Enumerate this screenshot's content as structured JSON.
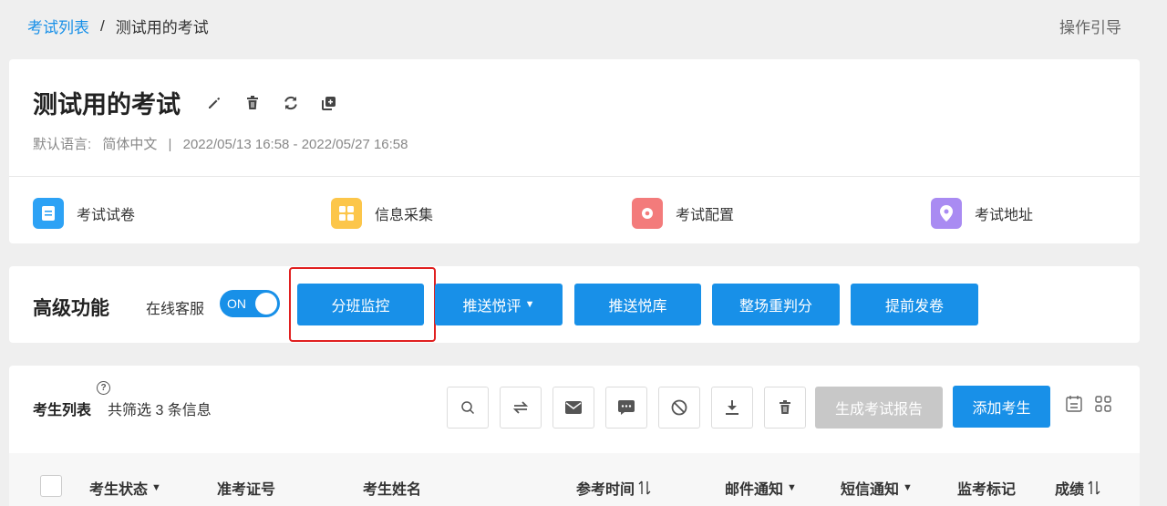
{
  "breadcrumb": {
    "parent": "考试列表",
    "separator": "/",
    "current": "测试用的考试"
  },
  "guide_label": "操作引导",
  "exam": {
    "title": "测试用的考试",
    "language_label": "默认语言:",
    "language": "简体中文",
    "meta_separator": "|",
    "date_range": "2022/05/13 16:58 - 2022/05/27 16:58",
    "features": [
      {
        "label": "考试试卷",
        "color": "#2da2f5"
      },
      {
        "label": "信息采集",
        "color": "#fcc64a"
      },
      {
        "label": "考试配置",
        "color": "#f37b7b"
      },
      {
        "label": "考试地址",
        "color": "#a98bf2"
      }
    ]
  },
  "advanced": {
    "title": "高级功能",
    "customer_service_label": "在线客服",
    "toggle_text": "ON",
    "buttons": {
      "class_monitor": "分班监控",
      "push_review": "推送悦评",
      "push_library": "推送悦库",
      "rejudge": "整场重判分",
      "early_submit": "提前发卷"
    }
  },
  "candidates": {
    "title": "考生列表",
    "help_symbol": "?",
    "count_text": "共筛选 3 条信息",
    "generate_report": "生成考试报告",
    "add_candidate": "添加考生",
    "columns": {
      "status": "考生状态",
      "ticket": "准考证号",
      "name": "考生姓名",
      "time": "参考时间",
      "email": "邮件通知",
      "sms": "短信通知",
      "proctor": "监考标记",
      "score": "成绩"
    }
  },
  "colors": {
    "accent": "#1890e8",
    "highlight": "#e02020",
    "disabled": "#c8c8c8"
  }
}
